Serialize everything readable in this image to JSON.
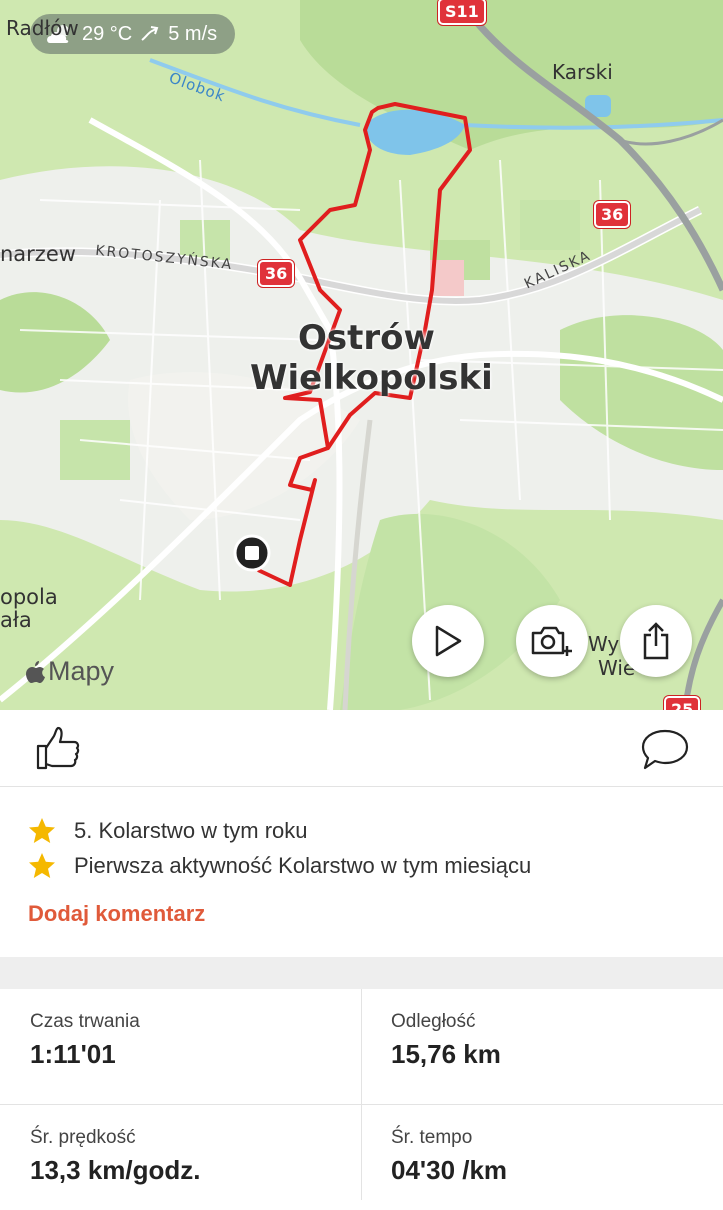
{
  "map": {
    "weather": {
      "temperature": "29 °C",
      "wind": "5 m/s",
      "icon": "partly-cloudy-icon",
      "wind_icon": "wind-arrow-icon"
    },
    "labels": {
      "radlow": "Radłów",
      "karski": "Karski",
      "olobok": "Olobok",
      "marzew": "narzew",
      "krotoszynska": "KROTOSZYŃSKA",
      "kaliska": "KALISKA",
      "city_line1": "Ostrów",
      "city_line2": "Wielkopolski",
      "topola": "opola",
      "mala": "ała",
      "wy": "Wy",
      "wie": "Wie"
    },
    "shields": {
      "s11": "S11",
      "r36a": "36",
      "r36b": "36",
      "r25": "25"
    },
    "attribution": "Mapy",
    "play_icon": "play-icon",
    "camera_icon": "camera-add-icon",
    "share_icon": "share-icon"
  },
  "actions": {
    "like_icon": "thumbs-up-icon",
    "comment_icon": "comment-bubble-icon"
  },
  "achievements": {
    "items": [
      {
        "text": "5. Kolarstwo w tym roku",
        "icon": "star-icon"
      },
      {
        "text": "Pierwsza aktywność Kolarstwo w tym miesiącu",
        "icon": "star-icon"
      }
    ],
    "add_comment": "Dodaj komentarz"
  },
  "stats": [
    {
      "label": "Czas trwania",
      "value": "1:11'01"
    },
    {
      "label": "Odległość",
      "value": "15,76 km"
    },
    {
      "label": "Śr. prędkość",
      "value": "13,3 km/godz."
    },
    {
      "label": "Śr. tempo",
      "value": "04'30 /km"
    }
  ],
  "colors": {
    "route": "#e01e1e",
    "accent": "#e05a3a",
    "star": "#f5b800",
    "map_green": "#cfe8b0"
  }
}
